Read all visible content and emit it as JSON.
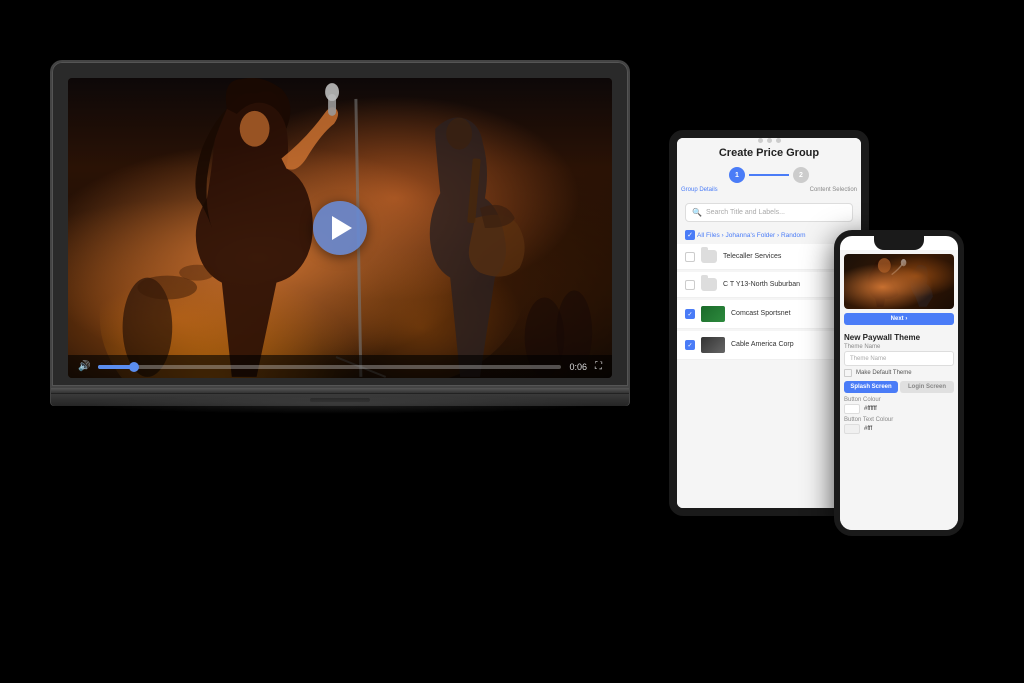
{
  "scene": {
    "background": "#000000"
  },
  "laptop": {
    "video": {
      "play_button_aria": "Play video",
      "time": "0:06",
      "time_full": "0:06"
    }
  },
  "tablet": {
    "dots": [
      "dot1",
      "dot2",
      "dot3"
    ],
    "title": "Create Price Group",
    "steps": [
      {
        "label": "Group Details",
        "state": "active",
        "number": "1"
      },
      {
        "label": "Content Selection",
        "state": "inactive",
        "number": "2"
      }
    ],
    "search_placeholder": "Search Title and Labels...",
    "breadcrumb": "All Files › Johanna's Folder › Random",
    "rows": [
      {
        "label": "Telecaller Services",
        "type": "folder",
        "checked": false
      },
      {
        "label": "C T Y13-North Suburban",
        "type": "folder",
        "checked": false
      },
      {
        "label": "Comcast Sportsnet",
        "type": "thumb-sports",
        "checked": true
      },
      {
        "label": "Cable America Corp",
        "type": "thumb-cable",
        "checked": true
      }
    ],
    "action_button": "Next ›"
  },
  "phone": {
    "section_title": "New Paywall Theme",
    "fields": [
      {
        "label": "Theme Name",
        "value": "",
        "placeholder": "Theme Name"
      },
      {
        "label": "Make Default Theme",
        "type": "checkbox"
      }
    ],
    "tabs": [
      {
        "label": "Splash Screen",
        "state": "active"
      },
      {
        "label": "Login Screen",
        "state": "inactive"
      }
    ],
    "button_color_label": "Button Colour",
    "button_color_value": "#ffffff",
    "button_text_color_label": "Button Text Colour",
    "button_text_color_value": "#fff"
  }
}
